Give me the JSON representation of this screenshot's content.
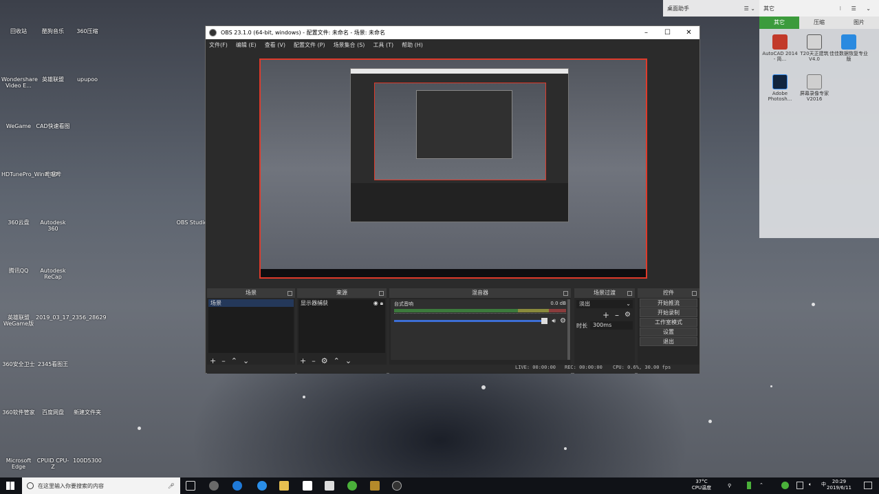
{
  "desktop": {
    "icons": [
      {
        "label": "回收站",
        "color": "#8a9aaa"
      },
      {
        "label": "酷狗音乐",
        "color": "#1e77d8"
      },
      {
        "label": "360压缩",
        "color": "#3b6fc4"
      },
      {
        "label": "Wondershare Video E...",
        "color": "#1a4fa0"
      },
      {
        "label": "英雄联盟",
        "color": "#b48a2a"
      },
      {
        "label": "upupoo",
        "color": "#2f6ad8"
      },
      {
        "label": "WeGame",
        "color": "#ffd23a"
      },
      {
        "label": "CAD快速看图",
        "color": "#2a5fb0"
      },
      {
        "label": "HDTunePro_Win8_10",
        "color": "#aa8844"
      },
      {
        "label": "哔哩哔",
        "color": "#ff9a2a"
      },
      {
        "label": "OBS Studio",
        "color": "#333"
      },
      {
        "label": "360云盘",
        "color": "#3b89c9"
      },
      {
        "label": "Autodesk 360",
        "color": "#4a7bb8"
      },
      {
        "label": "腾讯QQ",
        "color": "#222"
      },
      {
        "label": "Autodesk ReCap",
        "color": "#2261c2"
      },
      {
        "label": "英雄联盟WeGame版",
        "color": "#b48a2a"
      },
      {
        "label": "2019_03_17_2356_28629",
        "color": "#b27e5c"
      },
      {
        "label": "360安全卫士",
        "color": "#3ab03a"
      },
      {
        "label": "2345看图王",
        "color": "#4aa0e0"
      },
      {
        "label": "360软件管家",
        "color": "#e0663a"
      },
      {
        "label": "百度网盘",
        "color": "#2a83e8"
      },
      {
        "label": "新建文件夹",
        "color": "#d8c07a"
      },
      {
        "label": "Microsoft Edge",
        "color": "#e8e8e8"
      },
      {
        "label": "CPUID CPU-Z",
        "color": "#5a2d8a"
      },
      {
        "label": "100D5300",
        "color": "#d8c07a"
      }
    ]
  },
  "widget2": {
    "title": "桌面助手"
  },
  "widget": {
    "title": "其它",
    "tabs": [
      "其它",
      "压缩",
      "图片"
    ],
    "apps": [
      "AutoCAD 2014 - 简...",
      "T20天正建筑 V4.0",
      "佳佳数据恢复专业版",
      "Adobe Photosh...",
      "屏幕录像专家 V2016"
    ]
  },
  "obs": {
    "title": "OBS 23.1.0 (64-bit, windows) - 配置文件: 未命名 - 场景: 未命名",
    "menu": [
      "文件(F)",
      "编辑 (E)",
      "查看 (V)",
      "配置文件 (P)",
      "场景集合 (S)",
      "工具 (T)",
      "帮助 (H)"
    ],
    "docks": {
      "scenes": {
        "title": "场景",
        "items": [
          "场景"
        ]
      },
      "sources": {
        "title": "来源",
        "items": [
          "显示器捕获"
        ]
      },
      "mixer": {
        "title": "混音器",
        "channel": "台式音响",
        "level": "0.0 dB"
      },
      "transitions": {
        "title": "场景过渡",
        "transition": "淡出",
        "duration_label": "时长",
        "duration": "300ms"
      },
      "controls": {
        "title": "控件",
        "buttons": [
          "开始推流",
          "开始录制",
          "工作室模式",
          "设置",
          "退出"
        ]
      }
    },
    "status": {
      "live": "LIVE: 00:00:00",
      "rec": "REC: 00:00:00",
      "cpu": "CPU: 0.6%, 30.00 fps"
    }
  },
  "taskbar": {
    "search_placeholder": "在这里输入你要搜索的内容",
    "temp": "37°C",
    "temp_label": "CPU温度",
    "time": "20:29",
    "date": "2019/6/11"
  }
}
